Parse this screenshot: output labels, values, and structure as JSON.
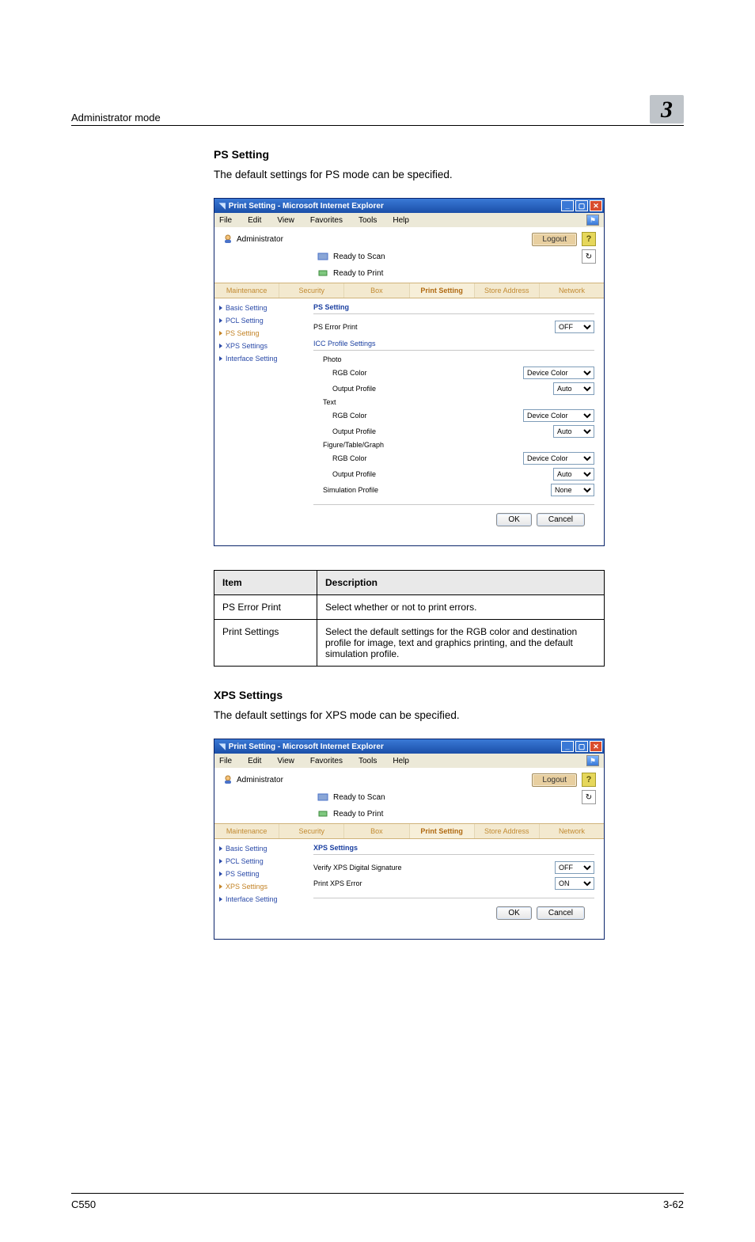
{
  "header": {
    "mode": "Administrator mode",
    "chapter": "3"
  },
  "footer": {
    "model": "C550",
    "page": "3-62"
  },
  "section1": {
    "heading": "PS Setting",
    "body": "The default settings for PS mode can be specified."
  },
  "section2": {
    "heading": "XPS Settings",
    "body": "The default settings for XPS mode can be specified."
  },
  "table": {
    "head_item": "Item",
    "head_desc": "Description",
    "rows": [
      {
        "item": "PS Error Print",
        "desc": "Select whether or not to print errors."
      },
      {
        "item": "Print Settings",
        "desc": "Select the default settings for the RGB color and destination profile for image, text and graphics printing, and the default simulation profile."
      }
    ]
  },
  "browser_common": {
    "title": "Print Setting - Microsoft Internet Explorer",
    "menu": {
      "file": "File",
      "edit": "Edit",
      "view": "View",
      "favorites": "Favorites",
      "tools": "Tools",
      "help": "Help"
    },
    "admin_label": "Administrator",
    "status_scan": "Ready to Scan",
    "status_print": "Ready to Print",
    "logout": "Logout",
    "help": "?",
    "tabs": [
      "Maintenance",
      "Security",
      "Box",
      "Print Setting",
      "Store Address",
      "Network"
    ],
    "sidebar": {
      "basic": "Basic Setting",
      "pcl": "PCL Setting",
      "ps": "PS Setting",
      "xps": "XPS Settings",
      "iface": "Interface Setting"
    },
    "ok": "OK",
    "cancel": "Cancel"
  },
  "ps_panel": {
    "title": "PS Setting",
    "error_print": "PS Error Print",
    "error_val": "OFF",
    "icc_head": "ICC Profile Settings",
    "photo": "Photo",
    "text": "Text",
    "ftg": "Figure/Table/Graph",
    "rgb_color": "RGB Color",
    "output_profile": "Output Profile",
    "sim_profile": "Simulation Profile",
    "device_color": "Device Color",
    "auto": "Auto",
    "none": "None"
  },
  "xps_panel": {
    "title": "XPS Settings",
    "verify": "Verify XPS Digital Signature",
    "verify_val": "OFF",
    "print_error": "Print XPS Error",
    "print_error_val": "ON"
  }
}
